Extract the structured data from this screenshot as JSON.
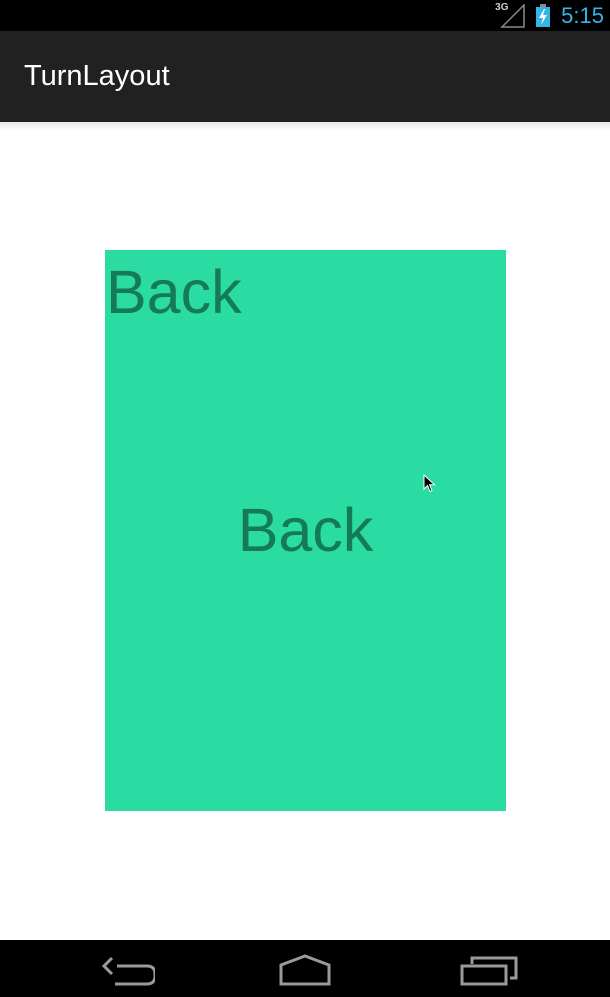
{
  "status_bar": {
    "network_type": "3G",
    "time": "5:15",
    "icons": [
      "signal-icon",
      "battery-charging-icon"
    ],
    "clock_color": "#33b5e5"
  },
  "action_bar": {
    "title": "TurnLayout",
    "background": "#212121"
  },
  "card": {
    "background": "#2bdca2",
    "text_color": "#147a57",
    "top_label": "Back",
    "center_label": "Back"
  },
  "nav_bar": {
    "buttons": [
      "back-icon",
      "home-icon",
      "recent-apps-icon"
    ]
  }
}
